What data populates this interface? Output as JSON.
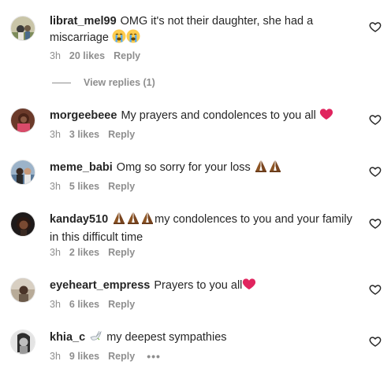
{
  "comments": [
    {
      "username": "librat_mel99",
      "text_part1": "OMG it's not their daughter, she had a miscarriage",
      "emoji_icons": [
        "loudly-crying-face-icon",
        "loudly-crying-face-icon"
      ],
      "time": "3h",
      "likes": "20 likes",
      "reply": "Reply",
      "view_replies": "View replies (1)"
    },
    {
      "username": "morgeebeee",
      "text_part1": "My prayers and condolences to you all",
      "emoji_icons": [
        "red-heart-icon"
      ],
      "time": "3h",
      "likes": "3 likes",
      "reply": "Reply"
    },
    {
      "username": "meme_babi",
      "text_part1": "Omg so sorry for your loss",
      "emoji_icons": [
        "folded-hands-icon",
        "folded-hands-icon"
      ],
      "time": "3h",
      "likes": "5 likes",
      "reply": "Reply"
    },
    {
      "username": "kanday510",
      "text_part1": "my condolences to you and your family in this difficult time",
      "emoji_icons": [
        "folded-hands-icon",
        "folded-hands-icon",
        "folded-hands-icon"
      ],
      "time": "3h",
      "likes": "2 likes",
      "reply": "Reply"
    },
    {
      "username": "eyeheart_empress",
      "text_part1": "Prayers to you all",
      "emoji_icons": [
        "red-heart-icon"
      ],
      "time": "3h",
      "likes": "6 likes",
      "reply": "Reply"
    },
    {
      "username": "khia_c",
      "text_part1": "my deepest sympathies",
      "emoji_icons": [
        "dove-icon"
      ],
      "time": "3h",
      "likes": "9 likes",
      "reply": "Reply",
      "more": "•••"
    }
  ],
  "colors": {
    "text": "#262626",
    "secondary": "#8e8e8e",
    "heart_emoji": "#e0245e",
    "hands_emoji": "#8d5524"
  }
}
